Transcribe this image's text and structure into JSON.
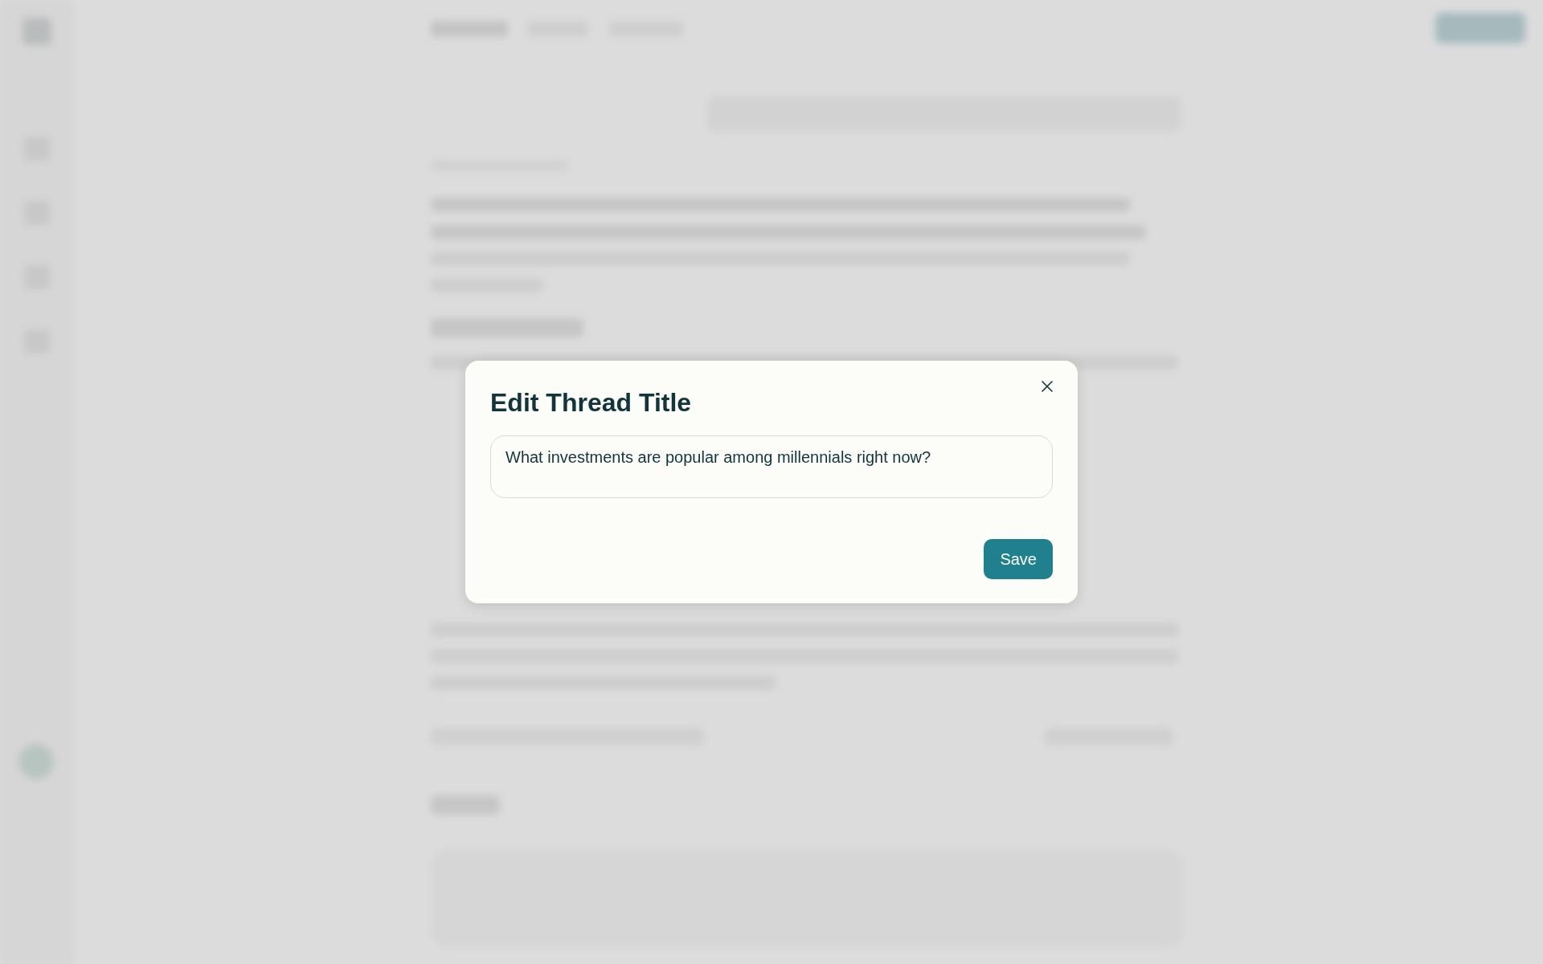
{
  "dialog": {
    "title": "Edit Thread Title",
    "title_field": {
      "value": "What investments are popular among millennials right now?"
    },
    "buttons": [
      {
        "kind": "primary",
        "label": "Save"
      }
    ]
  }
}
